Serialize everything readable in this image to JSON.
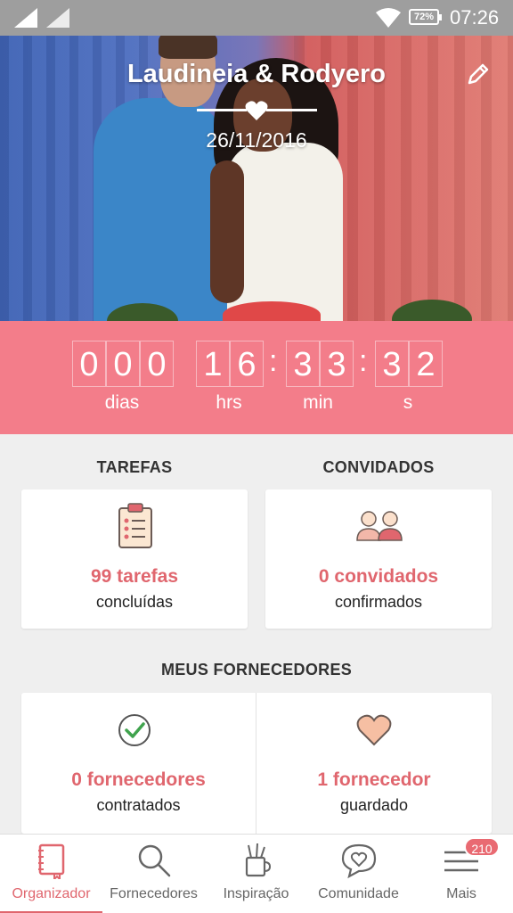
{
  "status_bar": {
    "time": "07:26",
    "battery": "72%"
  },
  "header": {
    "couple_names": "Laudineia & Rodyero",
    "date": "26/11/2016"
  },
  "countdown": {
    "days_digits": [
      "0",
      "0",
      "0"
    ],
    "hours_digits": [
      "1",
      "6"
    ],
    "minutes_digits": [
      "3",
      "3"
    ],
    "seconds_digits": [
      "3",
      "2"
    ],
    "labels": {
      "days": "dias",
      "hours": "hrs",
      "minutes": "min",
      "seconds": "s"
    }
  },
  "tasks": {
    "title": "TAREFAS",
    "count": "99 tarefas",
    "status": "concluídas"
  },
  "guests": {
    "title": "CONVIDADOS",
    "count": "0 convidados",
    "status": "confirmados"
  },
  "vendors": {
    "title": "MEUS FORNECEDORES",
    "hired": {
      "count": "0 fornecedores",
      "status": "contratados"
    },
    "saved": {
      "count": "1 fornecedor",
      "status": "guardado"
    }
  },
  "bottom_nav": {
    "items": [
      {
        "label": "Organizador",
        "icon": "notebook-icon"
      },
      {
        "label": "Fornecedores",
        "icon": "search-icon"
      },
      {
        "label": "Inspiração",
        "icon": "brush-cup-icon"
      },
      {
        "label": "Comunidade",
        "icon": "chat-heart-icon"
      },
      {
        "label": "Mais",
        "icon": "menu-icon"
      }
    ],
    "badge": "210"
  },
  "colors": {
    "accent": "#e0666e",
    "countdown_bg": "#f37d8a"
  }
}
